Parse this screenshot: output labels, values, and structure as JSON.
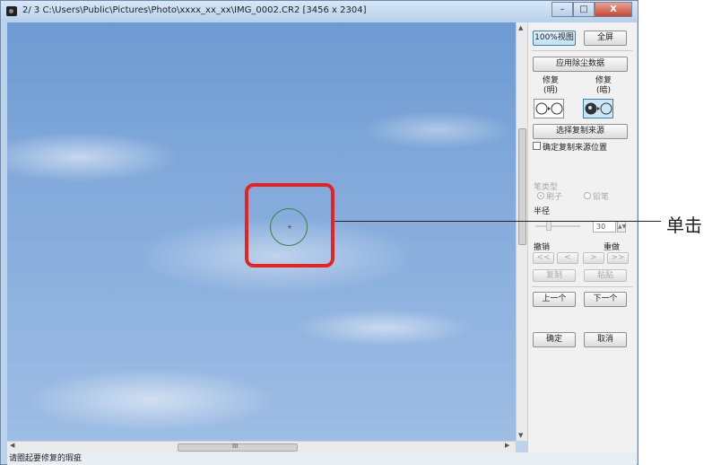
{
  "window": {
    "title": "2/ 3  C:\\Users\\Public\\Pictures\\Photo\\xxxx_xx_xx\\IMG_0002.CR2 [3456 x 2304]",
    "minimize": "–",
    "maximize": "□",
    "close": "X"
  },
  "panel": {
    "view100": "100%视图",
    "fullscreen": "全屏",
    "apply_dust_data": "应用除尘数据",
    "repair_light": "修复\n(明)",
    "repair_dark": "修复\n(暗)",
    "select_copy_source": "选择复制来源",
    "lock_copy_source": "确定复制来源位置",
    "pen_type": "笔类型",
    "brush": "刷子",
    "pencil": "铅笔",
    "radius": "半径",
    "radius_value": "30",
    "undo": "撤销",
    "redo": "重做",
    "undo_all": "<<",
    "undo_one": "<",
    "redo_one": ">",
    "redo_all": ">>",
    "copy": "复制",
    "paste": "粘贴",
    "prev": "上一个",
    "next": "下一个",
    "ok": "确定",
    "cancel": "取消"
  },
  "status": "请圈起要修复的瑕疵",
  "callout": "单击",
  "scroll_grip": "III"
}
